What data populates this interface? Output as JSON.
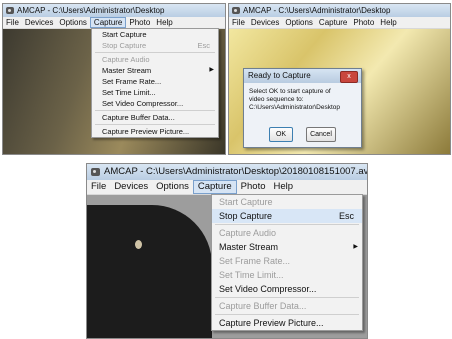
{
  "panel_top_left": {
    "title": "AMCAP - C:\\Users\\Administrator\\Desktop",
    "menu": [
      "File",
      "Devices",
      "Options",
      "Capture",
      "Photo",
      "Help"
    ],
    "capture_menu": [
      {
        "label": "Start Capture",
        "shortcut": "",
        "disabled": false
      },
      {
        "label": "Stop Capture",
        "shortcut": "Esc",
        "disabled": true
      },
      {
        "label": "Capture Audio",
        "shortcut": "",
        "disabled": true
      },
      {
        "label": "Master Stream",
        "shortcut": "",
        "disabled": false,
        "submenu": true
      },
      {
        "label": "Set Frame Rate...",
        "shortcut": "",
        "disabled": false
      },
      {
        "label": "Set Time Limit...",
        "shortcut": "",
        "disabled": false
      },
      {
        "label": "Set Video Compressor...",
        "shortcut": "",
        "disabled": false
      },
      {
        "label": "Capture Buffer Data...",
        "shortcut": "",
        "disabled": false
      },
      {
        "label": "Capture Preview Picture...",
        "shortcut": "",
        "disabled": false
      }
    ]
  },
  "panel_top_right": {
    "title": "AMCAP - C:\\Users\\Administrator\\Desktop",
    "menu": [
      "File",
      "Devices",
      "Options",
      "Capture",
      "Photo",
      "Help"
    ],
    "dialog": {
      "title": "Ready to Capture",
      "close_glyph": "x",
      "message_line1": "Select OK to start capture of",
      "message_line2": "video sequence to:",
      "message_line3": "C:\\Users\\Administrator\\Desktop",
      "ok_label": "OK",
      "cancel_label": "Cancel"
    }
  },
  "panel_bottom": {
    "title": "AMCAP - C:\\Users\\Administrator\\Desktop\\20180108151007.avi",
    "menu": [
      "File",
      "Devices",
      "Options",
      "Capture",
      "Photo",
      "Help"
    ],
    "capture_menu": [
      {
        "label": "Start Capture",
        "shortcut": "",
        "disabled": true
      },
      {
        "label": "Stop Capture",
        "shortcut": "Esc",
        "disabled": false
      },
      {
        "label": "Capture Audio",
        "shortcut": "",
        "disabled": true
      },
      {
        "label": "Master Stream",
        "shortcut": "",
        "disabled": false,
        "submenu": true
      },
      {
        "label": "Set Frame Rate...",
        "shortcut": "",
        "disabled": true
      },
      {
        "label": "Set Time Limit...",
        "shortcut": "",
        "disabled": true
      },
      {
        "label": "Set Video Compressor...",
        "shortcut": "",
        "disabled": false
      },
      {
        "label": "Capture Buffer Data...",
        "shortcut": "",
        "disabled": true
      },
      {
        "label": "Capture Preview Picture...",
        "shortcut": "",
        "disabled": false
      }
    ]
  },
  "colors": {
    "menu_highlight": "#d8e6f6",
    "disabled_text": "#9c9c9c",
    "dialog_close": "#c9463d"
  }
}
